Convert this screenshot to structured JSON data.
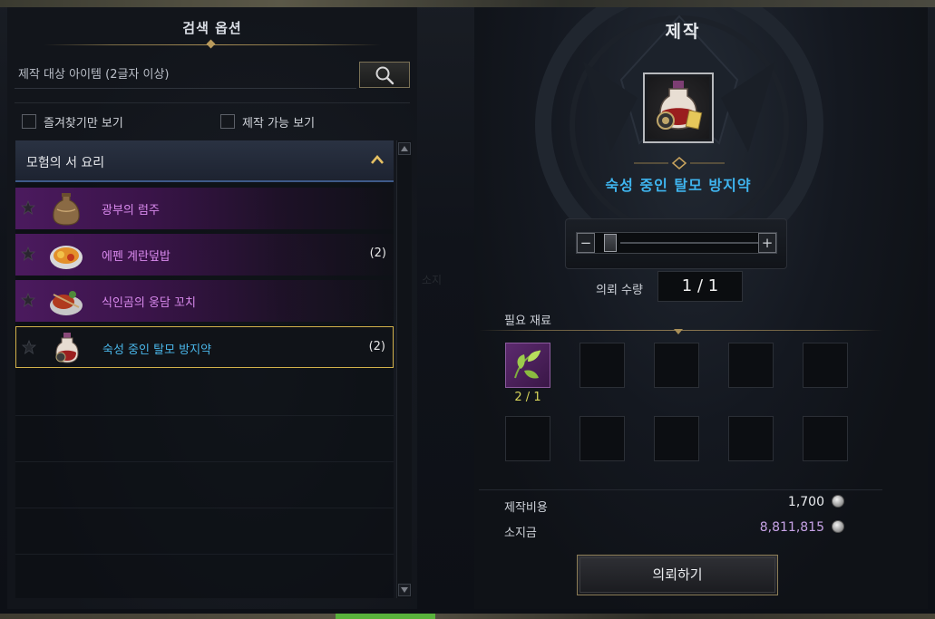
{
  "search_panel": {
    "title": "검색 옵션",
    "search_placeholder": "제작 대상 아이템 (2글자 이상)",
    "filters": [
      {
        "label": "즐겨찾기만 보기",
        "checked": false
      },
      {
        "label": "제작 가능 보기",
        "checked": false
      }
    ],
    "category": {
      "label": "모험의 서 요리",
      "expanded": true
    },
    "recipes": [
      {
        "name": "광부의 럼주",
        "count": "",
        "favorite": false,
        "icon": "rum-bottle-icon"
      },
      {
        "name": "에펜 계란덮밥",
        "count": "(2)",
        "favorite": false,
        "icon": "egg-rice-bowl-icon"
      },
      {
        "name": "식인곰의 웅담 꼬치",
        "count": "",
        "favorite": false,
        "icon": "skewer-dish-icon"
      },
      {
        "name": "숙성 중인 탈모 방지약",
        "count": "(2)",
        "favorite": false,
        "icon": "potion-bottle-icon",
        "selected": true
      }
    ]
  },
  "craft_panel": {
    "title": "제작",
    "item_name": "숙성 중인 탈모 방지약",
    "quantity_label": "의뢰 수량",
    "quantity": "1 / 1",
    "slider_minus": "−",
    "slider_plus": "+",
    "materials_label": "필요 재료",
    "materials": [
      {
        "icon": "herb-leaf-icon",
        "count": "2 / 1"
      }
    ],
    "cost_label": "제작비용",
    "cost": "1,700",
    "money_label": "소지금",
    "money": "8,811,815",
    "request_button": "의뢰하기",
    "background_hint": "소지",
    "colors": {
      "item_name": "#3fb5ef",
      "material_count": "#d7d45a",
      "money": "#c7a3e6",
      "rare_purple": "#4b1a5e",
      "selected_border": "#d2b14a"
    }
  }
}
